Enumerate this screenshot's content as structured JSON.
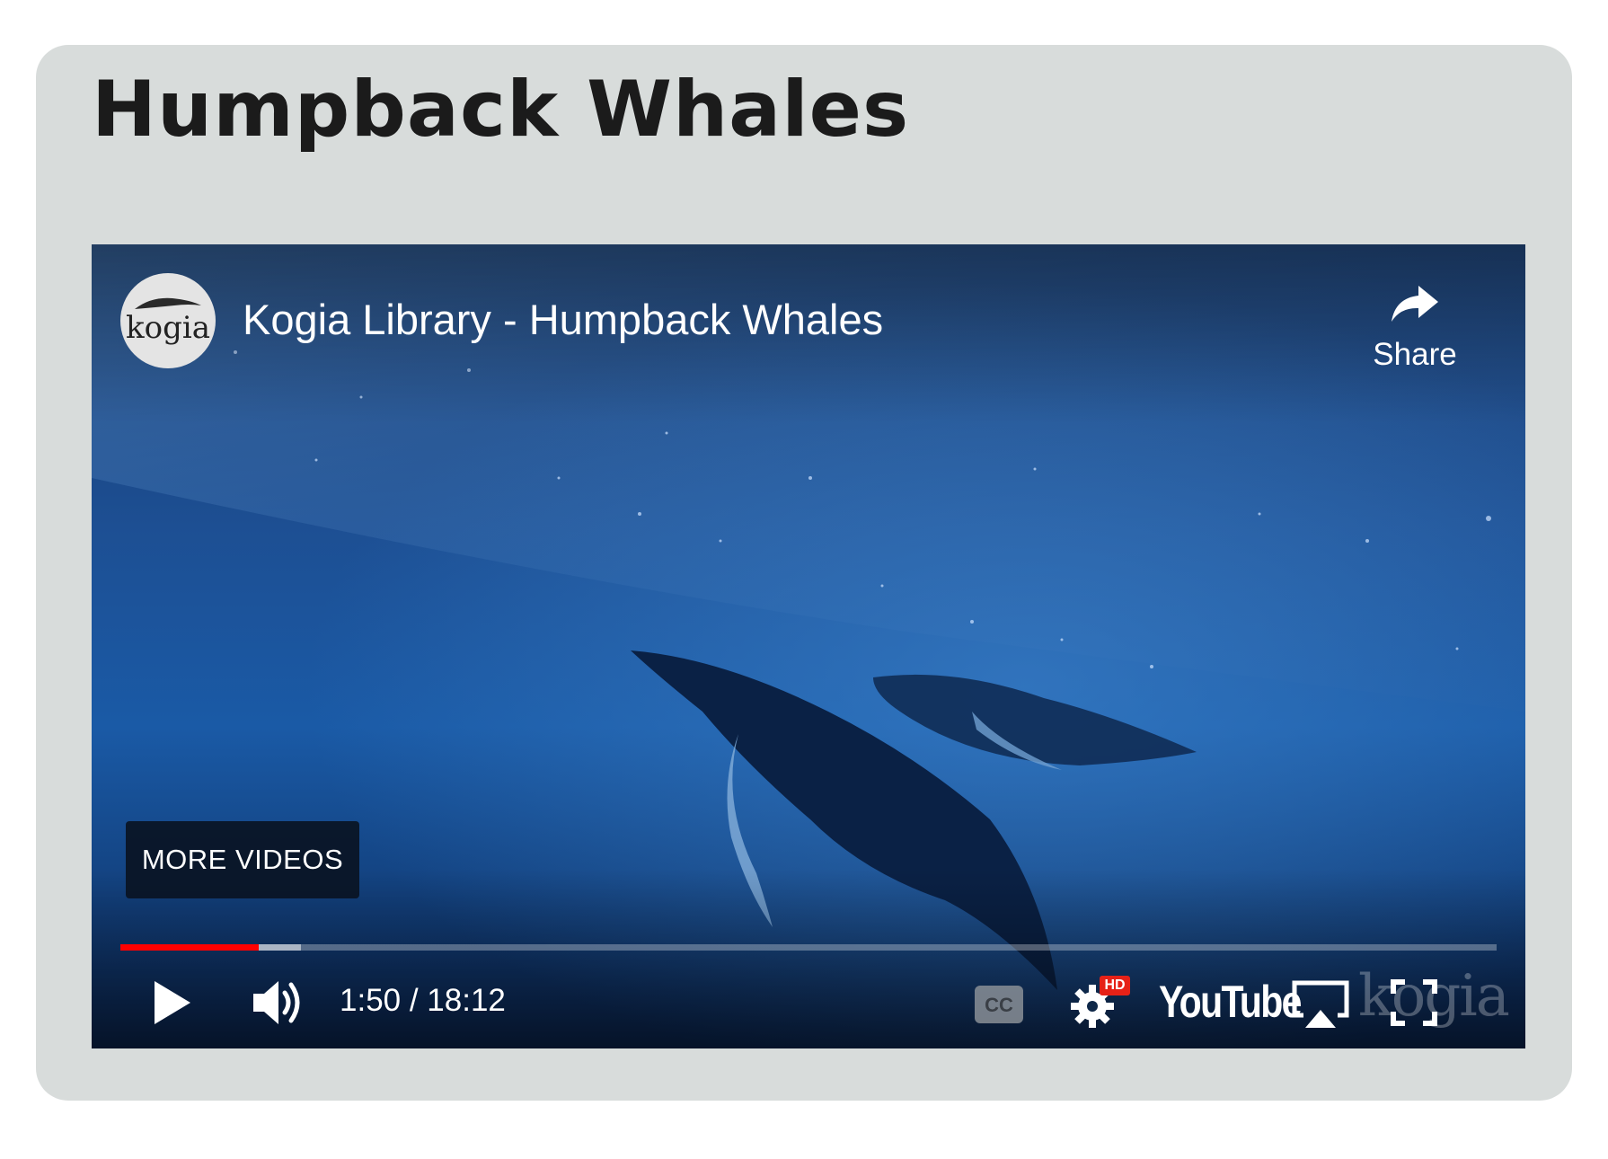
{
  "page": {
    "title": "Humpback Whales"
  },
  "player": {
    "channel_avatar_text": "kogia",
    "video_title": "Kogia Library - Humpback Whales",
    "share_label": "Share",
    "more_videos_label": "MORE VIDEOS",
    "current_time": "1:50",
    "duration": "18:12",
    "time_display": "1:50 / 18:12",
    "progress_played_fraction": 0.1007,
    "progress_buffered_fraction": 0.131,
    "settings_badge": "HD",
    "youtube_logo_text": "YouTube",
    "watermark_text": "kogia",
    "icons": [
      "play-icon",
      "volume-icon",
      "captions-icon",
      "settings-icon",
      "airplay-icon",
      "fullscreen-icon",
      "share-icon"
    ],
    "colors": {
      "progress_played": "#ff0000",
      "hd_badge": "#e62117",
      "card_background": "#d8dcdb"
    }
  }
}
